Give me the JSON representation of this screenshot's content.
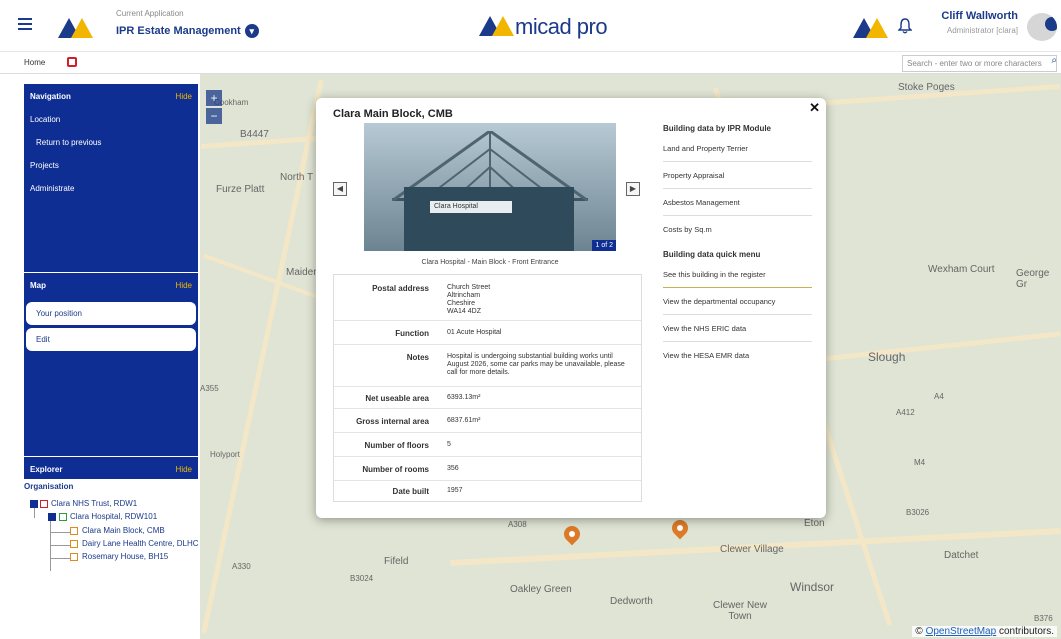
{
  "header": {
    "app_caption": "Current Application",
    "app_name": "IPR Estate Management",
    "brand": "micad pro",
    "user_name": "Cliff Wallworth",
    "user_role": "Administrator [clara]"
  },
  "subbar": {
    "home": "Home",
    "search_placeholder": "Search - enter two or more characters"
  },
  "sidebar": {
    "navigation": {
      "title": "Navigation",
      "hide": "Hide",
      "items": [
        "Location",
        "Return to previous",
        "Projects",
        "Administrate"
      ]
    },
    "map": {
      "title": "Map",
      "hide": "Hide",
      "buttons": [
        "Your position",
        "Edit"
      ]
    },
    "explorer": {
      "title": "Explorer",
      "hide": "Hide",
      "organisation": "Organisation",
      "tree": [
        "Clara NHS Trust, RDW1",
        "Clara Hospital, RDW101",
        "Clara Main Block, CMB",
        "Dairy Lane Health Centre, DLHC",
        "Rosemary House, BH15"
      ]
    }
  },
  "map": {
    "labels": [
      "B4447",
      "North T",
      "Furze Platt",
      "Maiden",
      "A308",
      "Fifeld",
      "A330",
      "B3024",
      "Oakley Green",
      "Dedworth",
      "Clewer Village",
      "Clewer New Town",
      "Windsor",
      "Eton",
      "Slough",
      "Wexham Court",
      "George Gr",
      "Stoke Poges",
      "A412",
      "A4",
      "M4",
      "B3026",
      "Datchet",
      "B376",
      "A355",
      "Cookham",
      "Holyport"
    ],
    "attribution_prefix": "©",
    "attribution_link": "OpenStreetMap",
    "attribution_suffix": "contributors."
  },
  "popup": {
    "title": "Clara Main Block, CMB",
    "close": "✕",
    "photo_sign": "Clara Hospital",
    "photo_counter": "1 of 2",
    "photo_caption": "Clara Hospital - Main Block - Front Entrance",
    "details": [
      {
        "label": "Postal address",
        "value": "Church Street\nAltrincham\nCheshire\nWA14 4DZ"
      },
      {
        "label": "Function",
        "value": "01 Acute Hospital"
      },
      {
        "label": "Notes",
        "value": "Hospital is undergoing substantial building works until August 2026, some car parks may be unavailable, please call for more details."
      },
      {
        "label": "Net useable area",
        "value": "6393.13m²"
      },
      {
        "label": "Gross internal area",
        "value": "6837.61m²"
      },
      {
        "label": "Number of floors",
        "value": "5"
      },
      {
        "label": "Number of rooms",
        "value": "356"
      },
      {
        "label": "Date built",
        "value": "1957"
      }
    ],
    "ipr_module_heading": "Building data by IPR Module",
    "ipr_module_links": [
      "Land and Property Terrier",
      "Property Appraisal",
      "Asbestos Management",
      "Costs by Sq.m"
    ],
    "quick_menu_heading": "Building data quick menu",
    "quick_menu_links": [
      "See this building in the register",
      "View the departmental occupancy",
      "View the NHS ERIC data",
      "View the HESA EMR data"
    ]
  },
  "colors": {
    "primary": "#0f2e94",
    "accent": "#f2b600",
    "pin": "#dc7a28"
  }
}
